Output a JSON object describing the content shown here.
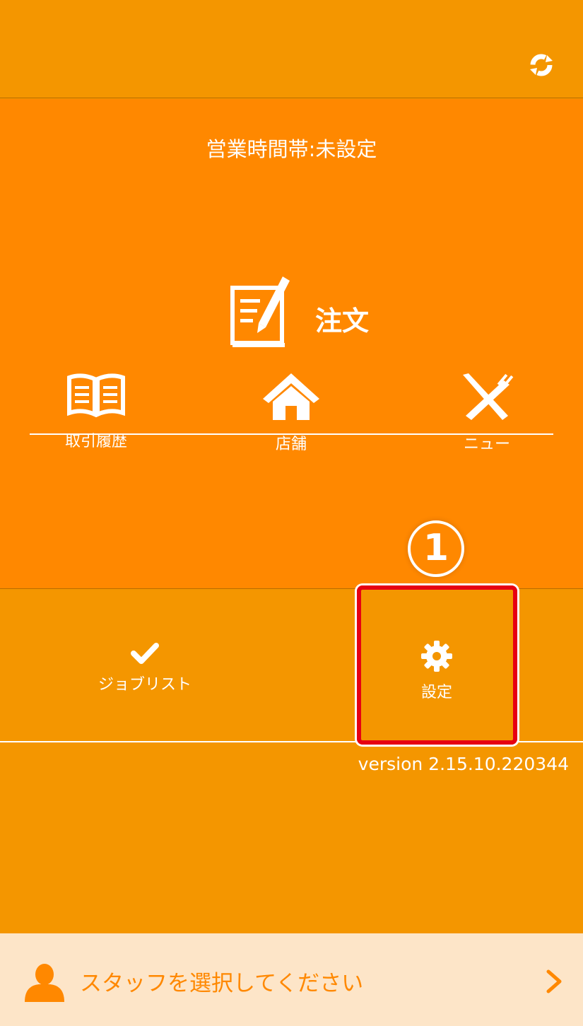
{
  "header": {
    "refresh_icon": "refresh-icon"
  },
  "main": {
    "business_hours": "営業時間帯:未設定",
    "order_label": "注文",
    "tiles": [
      {
        "label": "取引履歴",
        "icon": "book-icon"
      },
      {
        "label": "店舗",
        "icon": "home-icon"
      },
      {
        "label": "ニュー",
        "icon": "fork-knife-icon"
      }
    ]
  },
  "annotation": {
    "step": "1"
  },
  "row2": {
    "job_list_label": "ジョブリスト",
    "settings_label": "設定"
  },
  "version": "version 2.15.10.220344",
  "footer": {
    "staff_prompt": "スタッフを選択してください"
  },
  "colors": {
    "header_bg": "#f49600",
    "main_bg": "#ff8800",
    "footer_bg": "#fde5c8",
    "highlight": "#e60012"
  }
}
